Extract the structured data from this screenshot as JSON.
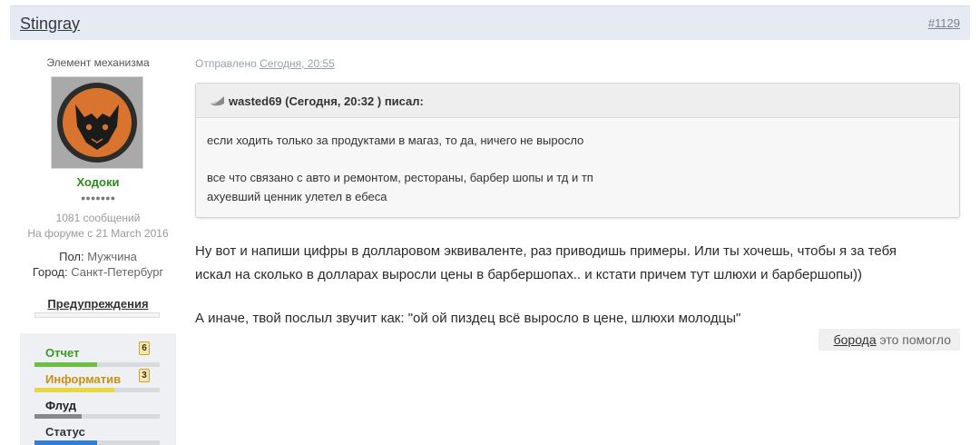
{
  "header": {
    "author": "Stingray",
    "post_number": "#1129"
  },
  "user": {
    "title": "Элемент механизма",
    "group": "Ходоки",
    "rank_pips": "●●●●●●●",
    "messages": "1081 сообщений",
    "joined": "На форуме с 21 March 2016",
    "gender_label": "Пол:",
    "gender_value": "Мужчина",
    "city_label": "Город:",
    "city_value": "Санкт-Петербург",
    "warnings_label": "Предупреждения",
    "reputation": [
      {
        "label": "Отчет",
        "badge": "6",
        "color": "#3a9a22",
        "bar_color": "#6cc040",
        "fill_fraction": 0.5
      },
      {
        "label": "Информатив",
        "badge": "3",
        "color": "#c79113",
        "bar_color": "#e8d83a",
        "fill_fraction": 0.64
      },
      {
        "label": "Флуд",
        "badge": "",
        "color": "#222222",
        "bar_color": "#888888",
        "fill_fraction": 0.38
      },
      {
        "label": "Статус",
        "badge": "",
        "color": "#333333",
        "bar_color": "#2f7fd6",
        "fill_fraction": 0.5
      }
    ]
  },
  "post": {
    "sent_prefix": "Отправлено",
    "sent_date": "Сегодня, 20:55",
    "quote": {
      "author": "wasted69 (Сегодня, 20:32 ) писал:",
      "lines": [
        "если ходить только за продуктами в магаз, то да, ничего не выросло",
        "все что связано с авто и ремонтом, рестораны, барбер шопы и тд и тп",
        "ахуевший ценник улетел в ебеса"
      ]
    },
    "message_lines": [
      "Ну вот и напиши цифры в долларовом эквиваленте, раз приводишь примеры. Или ты хочешь, чтобы я за тебя",
      "искал на сколько в долларах выросли цены в барбершопах.. и кстати причем тут шлюхи и барбершопы))",
      "А иначе, твой послыл звучит как: \"ой ой пиздец всё выросло в цене, шлюхи молодцы\""
    ],
    "thanks_user": "борода",
    "thanks_text": "это помогло"
  },
  "icons": {
    "quote": "speech-bubble-icon",
    "avatar": "black-cat-emblem"
  }
}
